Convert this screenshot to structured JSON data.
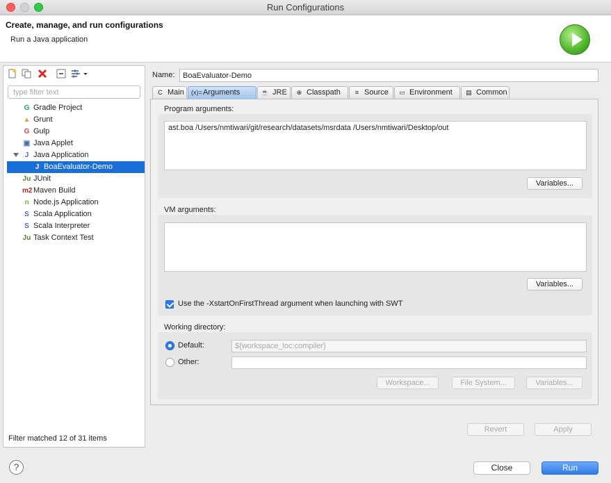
{
  "window": {
    "title": "Run Configurations"
  },
  "header": {
    "title": "Create, manage, and run configurations",
    "subtitle": "Run a Java application",
    "icon": "run-icon"
  },
  "left": {
    "toolbar_icons": [
      "new-config-icon",
      "duplicate-icon",
      "delete-icon",
      "collapse-all-icon",
      "filter-icon"
    ],
    "filter_placeholder": "type filter text",
    "tree": [
      {
        "label": "Gradle Project",
        "icon": "gradle-icon",
        "color": "#1ea35a",
        "glyph": "G"
      },
      {
        "label": "Grunt",
        "icon": "grunt-icon",
        "color": "#e2a13b",
        "glyph": "▲"
      },
      {
        "label": "Gulp",
        "icon": "gulp-icon",
        "color": "#cf4647",
        "glyph": "G"
      },
      {
        "label": "Java Applet",
        "icon": "java-applet-icon",
        "color": "#4a6ea8",
        "glyph": "▣"
      },
      {
        "label": "Java Application",
        "icon": "java-application-icon",
        "color": "#4a6ea8",
        "glyph": "J",
        "expanded": true
      },
      {
        "label": "BoaEvaluator-Demo",
        "icon": "java-config-icon",
        "color": "#4a6ea8",
        "glyph": "J",
        "child": true,
        "selected": true
      },
      {
        "label": "JUnit",
        "icon": "junit-icon",
        "color": "#5d7c2f",
        "glyph": "Ju"
      },
      {
        "label": "Maven Build",
        "icon": "maven-icon",
        "color": "#b32025",
        "glyph": "m2"
      },
      {
        "label": "Node.js Application",
        "icon": "nodejs-icon",
        "color": "#84b13a",
        "glyph": "n"
      },
      {
        "label": "Scala Application",
        "icon": "scala-application-icon",
        "color": "#4a6ea8",
        "glyph": "S"
      },
      {
        "label": "Scala Interpreter",
        "icon": "scala-interpreter-icon",
        "color": "#4a6ea8",
        "glyph": "S"
      },
      {
        "label": "Task Context Test",
        "icon": "task-context-icon",
        "color": "#5d7c2f",
        "glyph": "Ju"
      }
    ],
    "status": "Filter matched 12 of 31 items"
  },
  "config": {
    "name_label": "Name:",
    "name_value": "BoaEvaluator-Demo",
    "tabs": [
      {
        "label": "Main",
        "icon": "main-tab-icon",
        "glyph": "C"
      },
      {
        "label": "Arguments",
        "icon": "arguments-tab-icon",
        "glyph": "(x)=",
        "active": true
      },
      {
        "label": "JRE",
        "icon": "jre-tab-icon",
        "glyph": "☕"
      },
      {
        "label": "Classpath",
        "icon": "classpath-tab-icon",
        "glyph": "⊕"
      },
      {
        "label": "Source",
        "icon": "source-tab-icon",
        "glyph": "≡"
      },
      {
        "label": "Environment",
        "icon": "environment-tab-icon",
        "glyph": "▭"
      },
      {
        "label": "Common",
        "icon": "common-tab-icon",
        "glyph": "▤"
      }
    ],
    "program_args": {
      "label": "Program arguments:",
      "value": "ast.boa /Users/nmtiwari/git/research/datasets/msrdata /Users/nmtiwari/Desktop/out",
      "variables_label": "Variables..."
    },
    "vm_args": {
      "label": "VM arguments:",
      "value": "",
      "variables_label": "Variables..."
    },
    "swt_checkbox": {
      "label": "Use the -XstartOnFirstThread argument when launching with SWT",
      "checked": true
    },
    "working_dir": {
      "label": "Working directory:",
      "default_label": "Default:",
      "default_value": "${workspace_loc:compiler}",
      "other_label": "Other:",
      "other_value": "",
      "selected": "default",
      "workspace_label": "Workspace...",
      "filesystem_label": "File System...",
      "variables_label": "Variables..."
    },
    "revert_label": "Revert",
    "apply_label": "Apply"
  },
  "footer": {
    "help_glyph": "?",
    "close_label": "Close",
    "run_label": "Run"
  },
  "colors": {
    "accent": "#2f7be6",
    "selection": "#1a6ed8"
  }
}
